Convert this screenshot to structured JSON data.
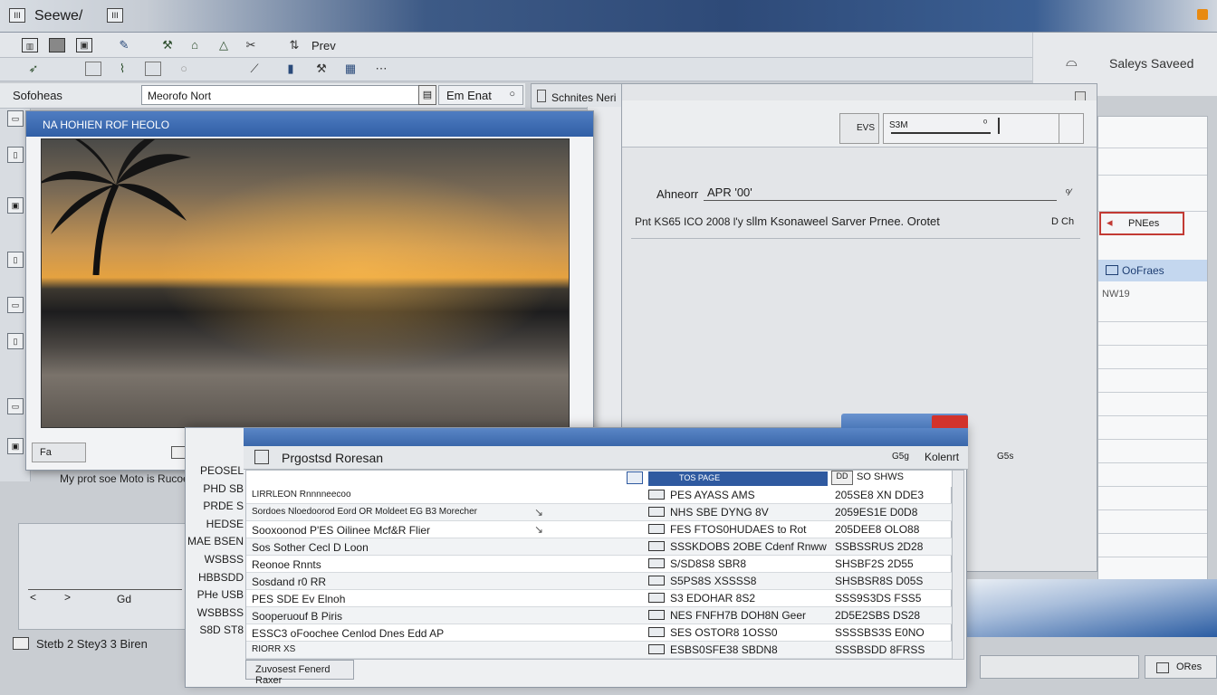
{
  "app": {
    "title": "Seewe/",
    "icon_left": "III",
    "icon_right": "III"
  },
  "toolbar": {
    "prev_label": "Prev",
    "saved_label": "Saleys Saveed"
  },
  "search_row": {
    "section_label": "Sofoheas",
    "search_value": "Meorofo Nort",
    "dropdown_label": "Em Enat"
  },
  "viewer": {
    "caption": "NA HOHIEN ROF HEOLO",
    "caption_below": "My prot soe Moto is Rucoeger",
    "footer_label": "Fa"
  },
  "left_time": {
    "t1": "<",
    "t2": ">",
    "t3": "Gd"
  },
  "bottom_status": "Stetb 2 Stey3 3 Biren",
  "mid_tab": "Schnites Neri",
  "props": {
    "seg_label": "EVS",
    "slider_label": "S3M",
    "row_label": "Ahneorr",
    "row_value": "APR '00'",
    "line2_prefix": "Pnt KS65 ICO 2008 l'y ",
    "line2_main": "sllm Ksonaweel Sarver Prnee. Orotet",
    "line2_right": "D Ch"
  },
  "right_panel": {
    "badge": "PNEes",
    "selected": "OoFraes",
    "sub": "NW19"
  },
  "bottom_right": "ORes",
  "results": {
    "title": "Prgostsd Roresan",
    "col_a": "G5g",
    "col_b": "Kolenrt",
    "col_c": "G5s",
    "subhead_sel": "TOS PAGE",
    "subhead_count": "DD",
    "subhead_right": "SO SHWS",
    "footer": "Zuvosest Fenerd Raxer",
    "left_labels": [
      "PEOSEL",
      "PHD SB",
      "PRDE S",
      "HEDSE",
      "MAE BSEN",
      "WSBSS",
      "HBBSDD",
      "PHe USB",
      "WSBBSS",
      "S8D ST8"
    ],
    "rows": [
      {
        "c1": "LIRRLEON   Rnnnneecoo",
        "c1_small": true,
        "arrow": "",
        "c2": "PES AYASS AMS",
        "c3": "205SE8 XN DDE3"
      },
      {
        "c1": "Sordoes    Nloedoorod Eord OR Moldeet EG B3 Morecher",
        "c1_small": true,
        "arrow": "↘",
        "c2": "NHS SBE DYNG 8V",
        "c3": "2059ES1E D0D8"
      },
      {
        "c1": "Sooxoonod P'ES Oilinee Mcf&R Flier",
        "c1_small": false,
        "arrow": "↘",
        "c2": "FES FTOS0HUDAES to Rot",
        "c3": "205DEE8 OLO88"
      },
      {
        "c1": "Sos Sother Cecl D Loon",
        "c1_small": false,
        "arrow": "",
        "c2": "SSSKDOBS 2OBE Cdenf Rnww",
        "c3": "SSBSSRUS 2D28"
      },
      {
        "c1": "Reonoe       Rnnts",
        "c1_small": false,
        "arrow": "",
        "c2": "S/SD8S8 SBR8",
        "c3": "SHSBF2S 2D55"
      },
      {
        "c1": "Sosdand r0 RR",
        "c1_small": false,
        "arrow": "",
        "c2": "S5PS8S XSSSS8",
        "c3": "SHSBSR8S D05S"
      },
      {
        "c1": "PES SDE Ev Elnoh",
        "c1_small": false,
        "arrow": "",
        "c2": "S3 EDOHAR 8S2",
        "c3": "SSS9S3DS FSS5"
      },
      {
        "c1": "Sooperuouf B Piris",
        "c1_small": false,
        "arrow": "",
        "c2": "NES FNFH7B DOH8N Geer",
        "c3": "2D5E2SBS DS28"
      },
      {
        "c1": "ESSC3 oFoochee Cenlod Dnes Edd    AP",
        "c1_small": false,
        "arrow": "",
        "c2": "SES OSTOR8 1OSS0",
        "c3": "SSSSBS3S E0NO"
      },
      {
        "c1": "RIORR XS",
        "c1_small": true,
        "arrow": "",
        "c2": "ESBS0SFE38 SBDN8",
        "c3": "SSSBSDD 8FRSS"
      }
    ]
  }
}
